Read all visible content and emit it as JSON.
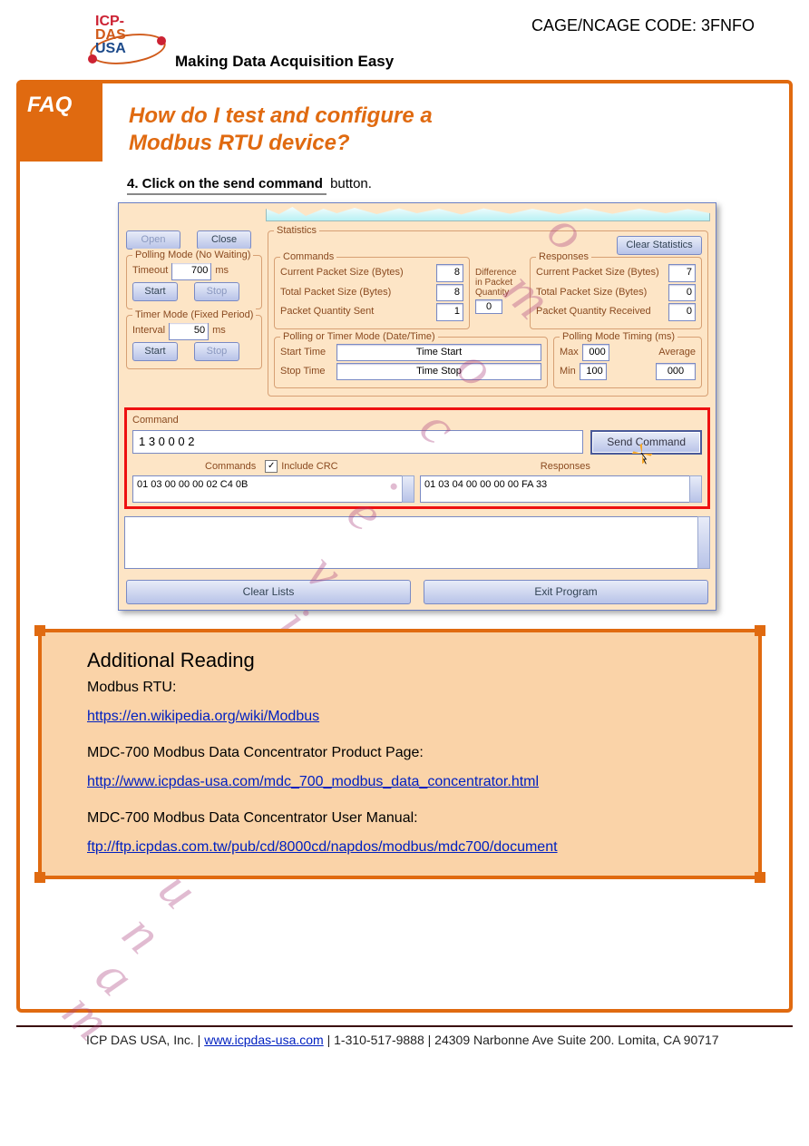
{
  "header": {
    "logo_line1": "ICP",
    "logo_dash": "-",
    "logo_line2": "DAS",
    "logo_line3": "USA",
    "tagline": "Making Data Acquisition Easy",
    "cage": "CAGE/NCAGE CODE: 3FNFO"
  },
  "page_tab_prefix": "FAQ",
  "title_l1": "How do I test and configure a",
  "title_l2": "Modbus RTU device?",
  "step_num": "4.",
  "step_text": " Click on the ",
  "step_btn": "send command",
  "step_tail": " button.",
  "ss": {
    "open": "Open",
    "close": "Close",
    "pollmode_title": "Polling Mode (No Waiting)",
    "timeout_lbl": "Timeout",
    "timeout_val": "700",
    "ms": "ms",
    "start": "Start",
    "stop": "Stop",
    "timermode_title": "Timer Mode (Fixed Period)",
    "interval_lbl": "Interval",
    "interval_val": "50",
    "stats": "Statistics",
    "clearstats": "Clear Statistics",
    "commands": "Commands",
    "responses": "Responses",
    "cps": "Current Packet Size (Bytes)",
    "cps_c": "8",
    "cps_r": "7",
    "tps": "Total Packet Size (Bytes)",
    "tps_c": "8",
    "tps_r": "0",
    "pqs": "Packet Quantity Sent",
    "pqs_v": "1",
    "pqr": "Packet Quantity Received",
    "pqr_v": "0",
    "diff1": "Difference",
    "diff2": "in Packet",
    "diff3": "Quantity",
    "diff_v": "0",
    "pt_title": "Polling  or Timer Mode  (Date/Time)",
    "starttime_lbl": "Start Time",
    "starttime_v": "Time Start",
    "stoptime_lbl": "Stop Time",
    "stoptime_v": "Time Stop",
    "pmt_title": "Polling Mode Timing (ms)",
    "max_lbl": "Max",
    "max_v": "000",
    "avg_lbl": "Average",
    "min_lbl": "Min",
    "min_v": "100",
    "avg_v": "000",
    "command_label": "Command",
    "command_value": "1 3 0 0 0 2",
    "send": "Send Command",
    "commands_label": "Commands",
    "include_crc": "Include CRC",
    "responses_label": "Responses",
    "cmd_list_0": "01 03 00 00 00 02 C4 0B",
    "resp_list_0": "01 03 04 00 00 00 00 FA 33",
    "clearlists": "Clear Lists",
    "exit": "Exit Program"
  },
  "ob": {
    "title": "Additional Reading",
    "p1": "Modbus RTU:",
    "l1": "https://en.wikipedia.org/wiki/Modbus",
    "p2": "MDC-700 Modbus Data Concentrator Product Page:",
    "l2": "http://www.icpdas-usa.com/mdc_700_modbus_data_concentrator.html",
    "p3": "MDC-700 Modbus Data Concentrator User Manual:",
    "l3": "ftp://ftp.icpdas.com.tw/pub/cd/8000cd/napdos/modbus/mdc700/document"
  },
  "foot": {
    "l1": "ICP DAS USA, Inc. | www.icpdas-usa.com | 1-310-517-9888 | 24309 Narbonne Ave Suite 200. Lomita, CA 90717",
    "url": "www.icpdas-usa.com"
  }
}
